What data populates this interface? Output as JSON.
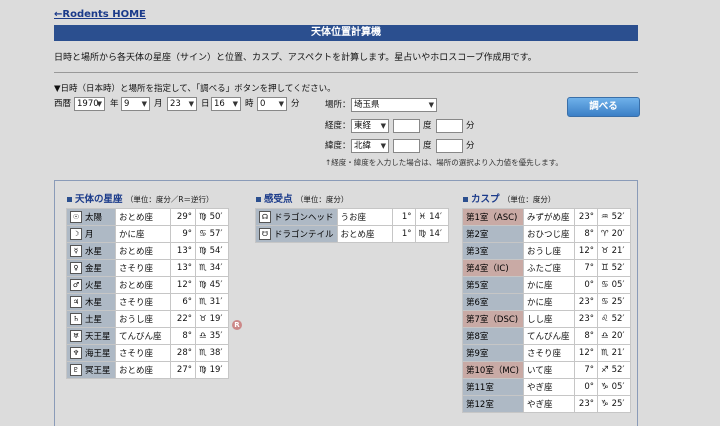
{
  "nav": {
    "home_link": "←Rodents HOME"
  },
  "page": {
    "title": "天体位置計算機",
    "intro": "日時と場所から各天体の星座（サイン）と位置、カスプ、アスペクトを計算します。星占いやホロスコープ作成用です。",
    "instruction": "▼日時（日本時）と場所を指定して、「調べる」ボタンを押してください。",
    "note": "↑経度・緯度を入力した場合は、場所の選択より入力値を優先します。"
  },
  "form": {
    "era": "西暦",
    "year": "1970",
    "year_unit": "年",
    "month": "9",
    "month_unit": "月",
    "day": "23",
    "day_unit": "日",
    "hour": "16",
    "hour_unit": "時",
    "minute": "0",
    "minute_unit": "分",
    "place_label": "場所：",
    "place": "埼玉県",
    "lon_label": "経度：",
    "lon_dir": "東経",
    "deg_unit": "度",
    "min_unit": "分",
    "lat_label": "緯度：",
    "lat_dir": "北緯",
    "submit": "調べる"
  },
  "planets": {
    "heading": "天体の星座",
    "unit": "（単位：度分／R＝逆行）",
    "rows": [
      {
        "icon": "sun-icon",
        "glyph": "☉",
        "name": "太陽",
        "sign": "おとめ座",
        "deg": "29°",
        "sym": "♍",
        "min": "50′"
      },
      {
        "icon": "moon-icon",
        "glyph": "☽",
        "name": "月",
        "sign": "かに座",
        "deg": "9°",
        "sym": "♋",
        "min": "57′"
      },
      {
        "icon": "mercury-icon",
        "glyph": "☿",
        "name": "水星",
        "sign": "おとめ座",
        "deg": "13°",
        "sym": "♍",
        "min": "54′"
      },
      {
        "icon": "venus-icon",
        "glyph": "♀",
        "name": "金星",
        "sign": "さそり座",
        "deg": "13°",
        "sym": "♏",
        "min": "34′"
      },
      {
        "icon": "mars-icon",
        "glyph": "♂",
        "name": "火星",
        "sign": "おとめ座",
        "deg": "12°",
        "sym": "♍",
        "min": "45′"
      },
      {
        "icon": "jupiter-icon",
        "glyph": "♃",
        "name": "木星",
        "sign": "さそり座",
        "deg": "6°",
        "sym": "♏",
        "min": "31′"
      },
      {
        "icon": "saturn-icon",
        "glyph": "♄",
        "name": "土星",
        "sign": "おうし座",
        "deg": "22°",
        "sym": "♉",
        "min": "19′"
      },
      {
        "icon": "uranus-icon",
        "glyph": "♅",
        "name": "天王星",
        "sign": "てんびん座",
        "deg": "8°",
        "sym": "♎",
        "min": "35′"
      },
      {
        "icon": "neptune-icon",
        "glyph": "♆",
        "name": "海王星",
        "sign": "さそり座",
        "deg": "28°",
        "sym": "♏",
        "min": "38′"
      },
      {
        "icon": "pluto-icon",
        "glyph": "♇",
        "name": "冥王星",
        "sign": "おとめ座",
        "deg": "27°",
        "sym": "♍",
        "min": "19′"
      }
    ],
    "retro_badge": "R"
  },
  "sensitive": {
    "heading": "感受点",
    "unit": "（単位：度分）",
    "rows": [
      {
        "icon": "dragon-head-icon",
        "glyph": "☊",
        "name": "ドラゴンヘッド",
        "sign": "うお座",
        "deg": "1°",
        "sym": "♓",
        "min": "14′"
      },
      {
        "icon": "dragon-tail-icon",
        "glyph": "☋",
        "name": "ドラゴンテイル",
        "sign": "おとめ座",
        "deg": "1°",
        "sym": "♍",
        "min": "14′"
      }
    ]
  },
  "cusps": {
    "heading": "カスプ",
    "unit": "（単位：度分）",
    "rows": [
      {
        "name": "第1室（ASC)",
        "sign": "みずがめ座",
        "deg": "23°",
        "sym": "♒",
        "min": "52′",
        "hl": true
      },
      {
        "name": "第2室",
        "sign": "おひつじ座",
        "deg": "8°",
        "sym": "♈",
        "min": "20′",
        "hl": false
      },
      {
        "name": "第3室",
        "sign": "おうし座",
        "deg": "12°",
        "sym": "♉",
        "min": "21′",
        "hl": false
      },
      {
        "name": "第4室（IC)",
        "sign": "ふたご座",
        "deg": "7°",
        "sym": "♊",
        "min": "52′",
        "hl": true
      },
      {
        "name": "第5室",
        "sign": "かに座",
        "deg": "0°",
        "sym": "♋",
        "min": "05′",
        "hl": false
      },
      {
        "name": "第6室",
        "sign": "かに座",
        "deg": "23°",
        "sym": "♋",
        "min": "25′",
        "hl": false
      },
      {
        "name": "第7室（DSC)",
        "sign": "しし座",
        "deg": "23°",
        "sym": "♌",
        "min": "52′",
        "hl": true
      },
      {
        "name": "第8室",
        "sign": "てんびん座",
        "deg": "8°",
        "sym": "♎",
        "min": "20′",
        "hl": false
      },
      {
        "name": "第9室",
        "sign": "さそり座",
        "deg": "12°",
        "sym": "♏",
        "min": "21′",
        "hl": false
      },
      {
        "name": "第10室（MC)",
        "sign": "いて座",
        "deg": "7°",
        "sym": "♐",
        "min": "52′",
        "hl": true
      },
      {
        "name": "第11室",
        "sign": "やぎ座",
        "deg": "0°",
        "sym": "♑",
        "min": "05′",
        "hl": false
      },
      {
        "name": "第12室",
        "sign": "やぎ座",
        "deg": "23°",
        "sym": "♑",
        "min": "25′",
        "hl": false
      }
    ]
  },
  "colors": {
    "accent": "#2b4f8f",
    "button": "#4a8fd6",
    "cusp_highlight": "#c9aaa5"
  }
}
